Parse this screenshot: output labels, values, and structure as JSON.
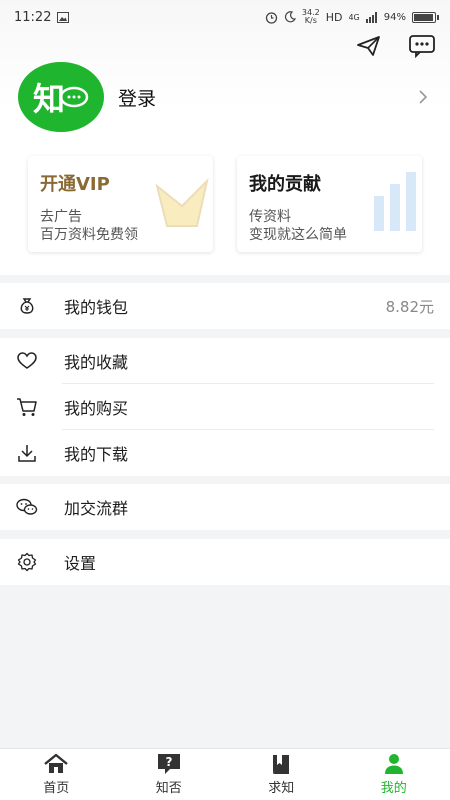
{
  "status_bar": {
    "time": "11:22",
    "speed_top": "34.2",
    "speed_unit": "K/s",
    "network": "HD",
    "signal": "4G",
    "battery": "94%"
  },
  "profile": {
    "avatar_text": "知",
    "login_label": "登录"
  },
  "cards": {
    "vip": {
      "title": "开通VIP",
      "line1": "去广告",
      "line2": "百万资料免费领"
    },
    "contrib": {
      "title": "我的贡献",
      "line1": "传资料",
      "line2": "变现就这么简单"
    }
  },
  "menu": {
    "wallet": {
      "label": "我的钱包",
      "value": "8.82元"
    },
    "favorites": {
      "label": "我的收藏"
    },
    "purchases": {
      "label": "我的购买"
    },
    "downloads": {
      "label": "我的下载"
    },
    "groups": {
      "label": "加交流群"
    },
    "settings": {
      "label": "设置"
    }
  },
  "tabs": [
    {
      "label": "首页",
      "icon": "home-icon"
    },
    {
      "label": "知否",
      "icon": "question-icon"
    },
    {
      "label": "求知",
      "icon": "book-icon"
    },
    {
      "label": "我的",
      "icon": "person-icon"
    }
  ],
  "colors": {
    "accent": "#1fb52e",
    "vip_gold": "#8a6a34"
  }
}
